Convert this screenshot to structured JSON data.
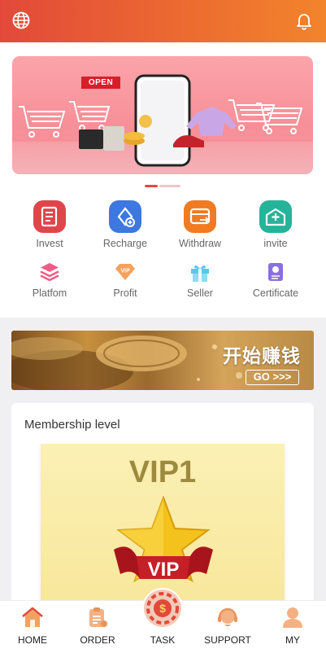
{
  "header": {
    "left_icon": "globe-icon",
    "right_icon": "bell-icon"
  },
  "banner": {
    "sign_text": "OPEN"
  },
  "quick_actions": [
    {
      "label": "Invest",
      "icon": "invest-icon"
    },
    {
      "label": "Recharge",
      "icon": "recharge-icon"
    },
    {
      "label": "Withdraw",
      "icon": "withdraw-icon"
    },
    {
      "label": "invite",
      "icon": "invite-icon"
    },
    {
      "label": "Platfom",
      "icon": "platform-icon"
    },
    {
      "label": "Profit",
      "icon": "profit-vip-icon"
    },
    {
      "label": "Seller",
      "icon": "gift-icon"
    },
    {
      "label": "Certificate",
      "icon": "certificate-icon"
    }
  ],
  "promo": {
    "title": "开始赚钱",
    "button": "GO >>>"
  },
  "membership": {
    "title": "Membership level",
    "level": "VIP1",
    "badge_text": "VIP"
  },
  "tabbar": [
    {
      "label": "HOME",
      "icon": "home-icon"
    },
    {
      "label": "ORDER",
      "icon": "order-icon"
    },
    {
      "label": "TASK",
      "icon": "task-icon"
    },
    {
      "label": "SUPPORT",
      "icon": "support-icon"
    },
    {
      "label": "MY",
      "icon": "user-icon"
    }
  ],
  "colors": {
    "accent": "#e2493a",
    "accent_end": "#f2842b",
    "tab_icon": "#f4b183"
  }
}
